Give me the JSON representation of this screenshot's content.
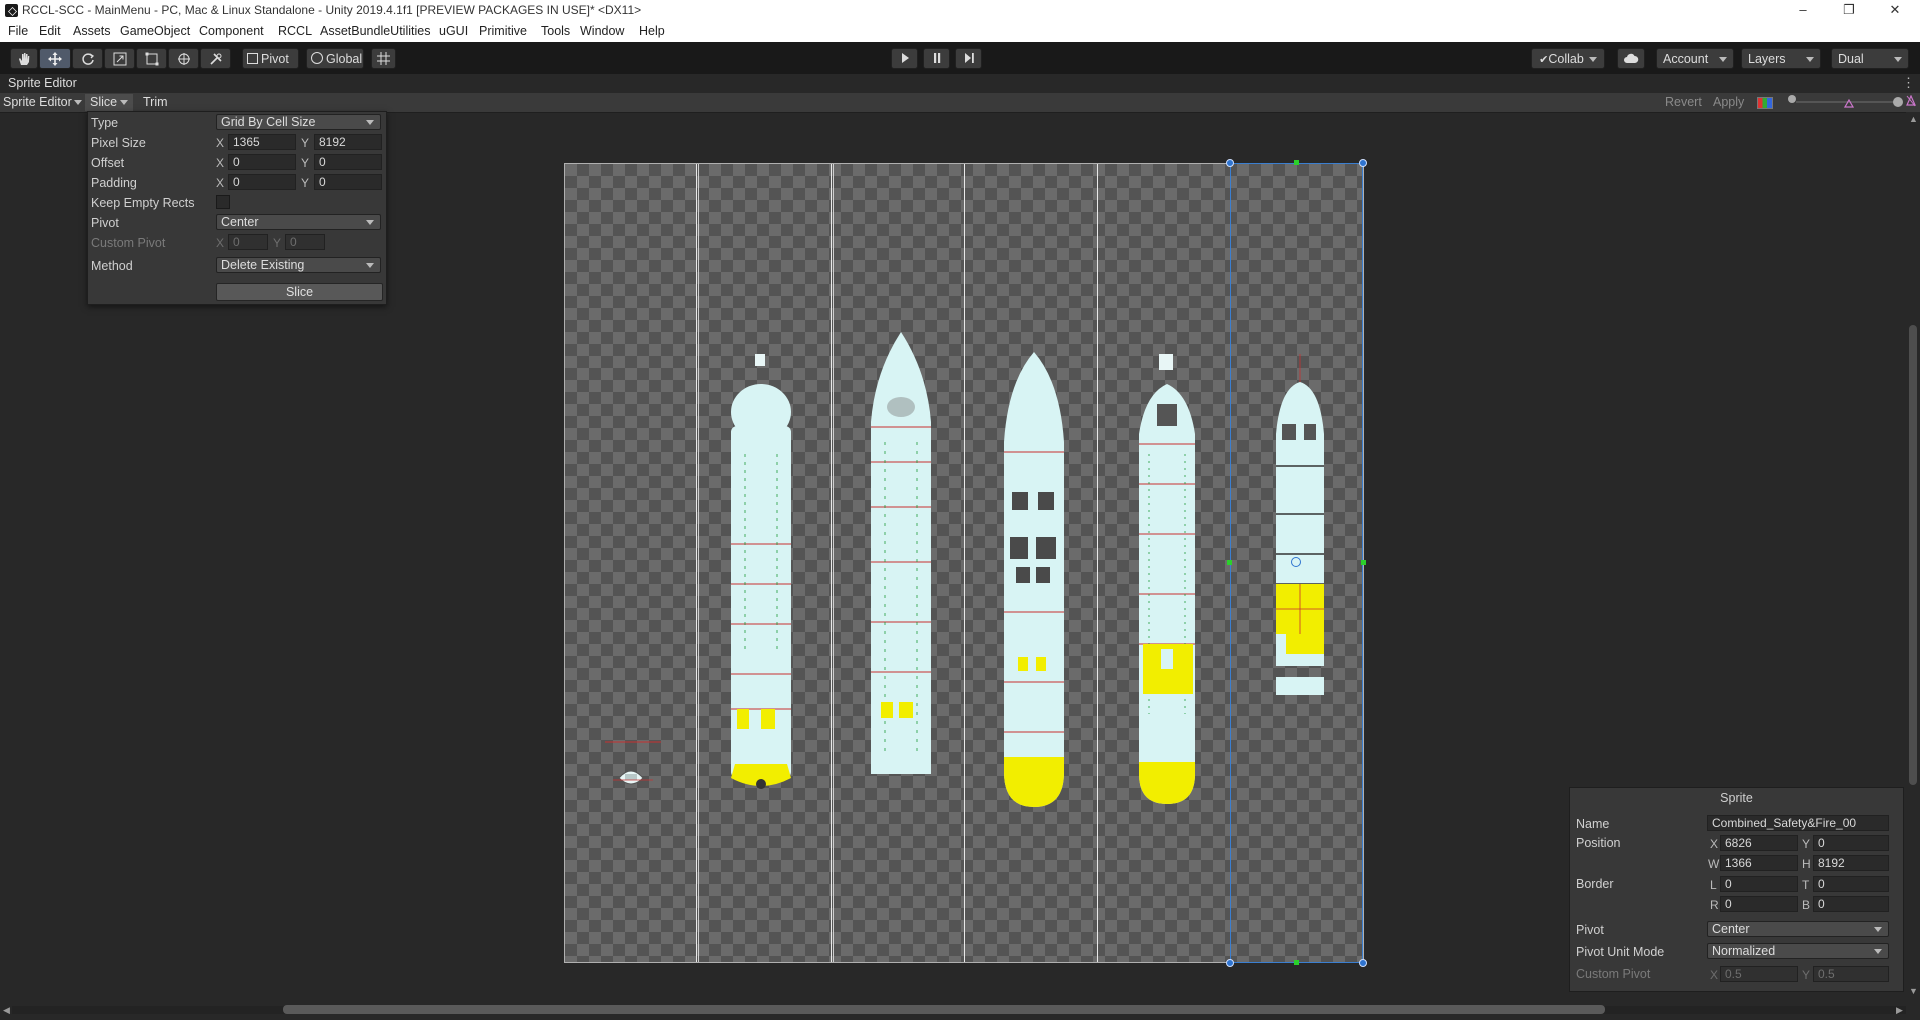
{
  "window": {
    "title": "RCCL-SCC - MainMenu - PC, Mac & Linux Standalone - Unity 2019.4.1f1 [PREVIEW PACKAGES IN USE]* <DX11>",
    "minimize": "–",
    "maximize": "❐",
    "close": "✕"
  },
  "menu": [
    "File",
    "Edit",
    "Assets",
    "GameObject",
    "Component",
    "RCCL",
    "AssetBundleUtilities",
    "uGUI",
    "Primitive",
    "Tools",
    "Window",
    "Help"
  ],
  "toolbar": {
    "pivot_label": "Pivot",
    "global_label": "Global",
    "collab_label": "Collab",
    "account_label": "Account",
    "layers_label": "Layers",
    "layout_label": "Dual"
  },
  "window_tab": {
    "label": "Sprite Editor"
  },
  "editor_toolbar": {
    "mode_label": "Sprite Editor",
    "slice_label": "Slice",
    "trim_label": "Trim",
    "revert_label": "Revert",
    "apply_label": "Apply"
  },
  "slice_panel": {
    "type_label": "Type",
    "type_value": "Grid By Cell Size",
    "pixel_size_label": "Pixel Size",
    "pixel_size_x": "1365",
    "pixel_size_y": "8192",
    "offset_label": "Offset",
    "offset_x": "0",
    "offset_y": "0",
    "padding_label": "Padding",
    "padding_x": "0",
    "padding_y": "0",
    "keep_empty_label": "Keep Empty Rects",
    "keep_empty_checked": false,
    "pivot_label": "Pivot",
    "pivot_value": "Center",
    "custom_pivot_label": "Custom Pivot",
    "custom_pivot_x": "0",
    "custom_pivot_y": "0",
    "method_label": "Method",
    "method_value": "Delete Existing",
    "slice_button": "Slice",
    "x_label": "X",
    "y_label": "Y"
  },
  "sprite_panel": {
    "title": "Sprite",
    "name_label": "Name",
    "name_value": "Combined_Safety&Fire_00",
    "position_label": "Position",
    "x": "6826",
    "y": "0",
    "w": "1366",
    "h": "8192",
    "border_label": "Border",
    "l": "0",
    "t": "0",
    "r": "0",
    "b": "0",
    "pivot_label": "Pivot",
    "pivot_value": "Center",
    "pivot_unit_mode_label": "Pivot Unit Mode",
    "pivot_unit_mode_value": "Normalized",
    "custom_pivot_label": "Custom Pivot",
    "custom_pivot_x": "0.5",
    "custom_pivot_y": "0.5",
    "x_label": "X",
    "y_label": "Y",
    "w_label": "W",
    "h_label": "H",
    "l_label": "L",
    "t_label": "T",
    "r_label": "R",
    "b_label": "B"
  },
  "colors": {
    "accent": "#2f74d0",
    "ship_fill": "#d8f4f4",
    "highlight_yellow": "#f2ee00",
    "detail_red": "#c83030",
    "detail_green": "#1e9a3a"
  }
}
